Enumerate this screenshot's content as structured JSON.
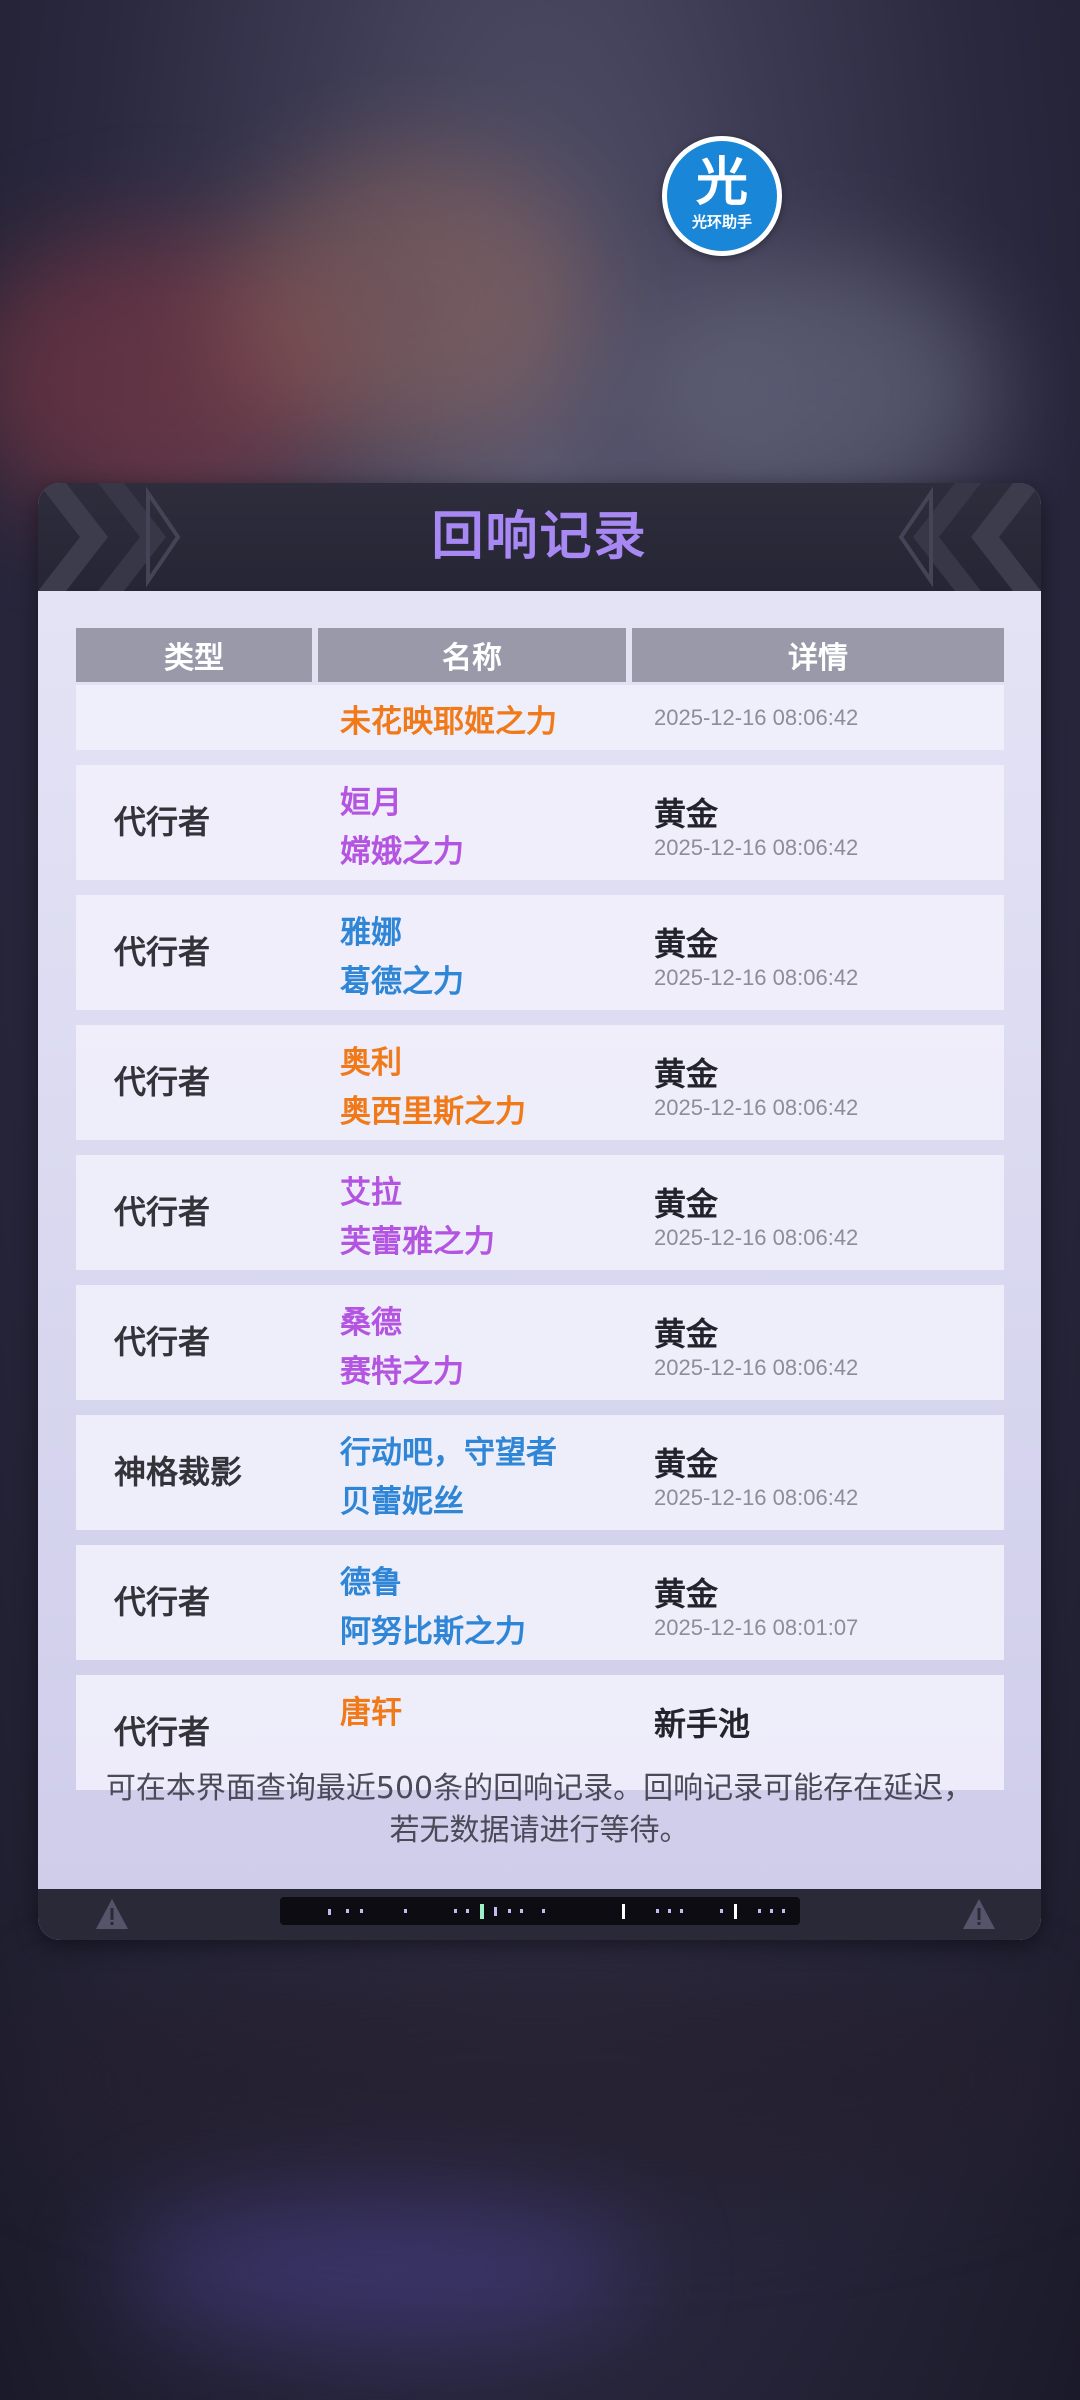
{
  "logo": {
    "glyph": "光",
    "text": "光环助手"
  },
  "panel": {
    "title": "回响记录",
    "columns": [
      "类型",
      "名称",
      "详情"
    ],
    "rows": [
      {
        "type": "",
        "name1": "",
        "name2": "未花映耶姬之力",
        "grade": "",
        "time": "2025-12-16 08:06:42",
        "name_color": "#f07a1a"
      },
      {
        "type": "代行者",
        "name1": "姮月",
        "name2": "嫦娥之力",
        "grade": "黄金",
        "time": "2025-12-16 08:06:42",
        "name_color": "#b455e2"
      },
      {
        "type": "代行者",
        "name1": "雅娜",
        "name2": "葛德之力",
        "grade": "黄金",
        "time": "2025-12-16 08:06:42",
        "name_color": "#2f86d6"
      },
      {
        "type": "代行者",
        "name1": "奥利",
        "name2": "奥西里斯之力",
        "grade": "黄金",
        "time": "2025-12-16 08:06:42",
        "name_color": "#f07a1a"
      },
      {
        "type": "代行者",
        "name1": "艾拉",
        "name2": "芙蕾雅之力",
        "grade": "黄金",
        "time": "2025-12-16 08:06:42",
        "name_color": "#b455e2"
      },
      {
        "type": "代行者",
        "name1": "桑德",
        "name2": "赛特之力",
        "grade": "黄金",
        "time": "2025-12-16 08:06:42",
        "name_color": "#b455e2"
      },
      {
        "type": "神格裁影",
        "name1": "行动吧，守望者",
        "name2": "贝蕾妮丝",
        "grade": "黄金",
        "time": "2025-12-16 08:06:42",
        "name_color": "#2f86d6"
      },
      {
        "type": "代行者",
        "name1": "德鲁",
        "name2": "阿努比斯之力",
        "grade": "黄金",
        "time": "2025-12-16 08:01:07",
        "name_color": "#2f86d6"
      },
      {
        "type": "代行者",
        "name1": "唐轩",
        "name2": "",
        "grade": "新手池",
        "time": "",
        "name_color": "#f07a1a"
      }
    ],
    "notice": "可在本界面查询最近500条的回响记录。回响记录可能存在延迟，若无数据请进行等待。"
  },
  "colors": {
    "title": "#a888f2",
    "header_bg": "#2e2d3c",
    "body_bg": "#d7d6ef"
  },
  "icons": {
    "warning": "warning-icon"
  }
}
